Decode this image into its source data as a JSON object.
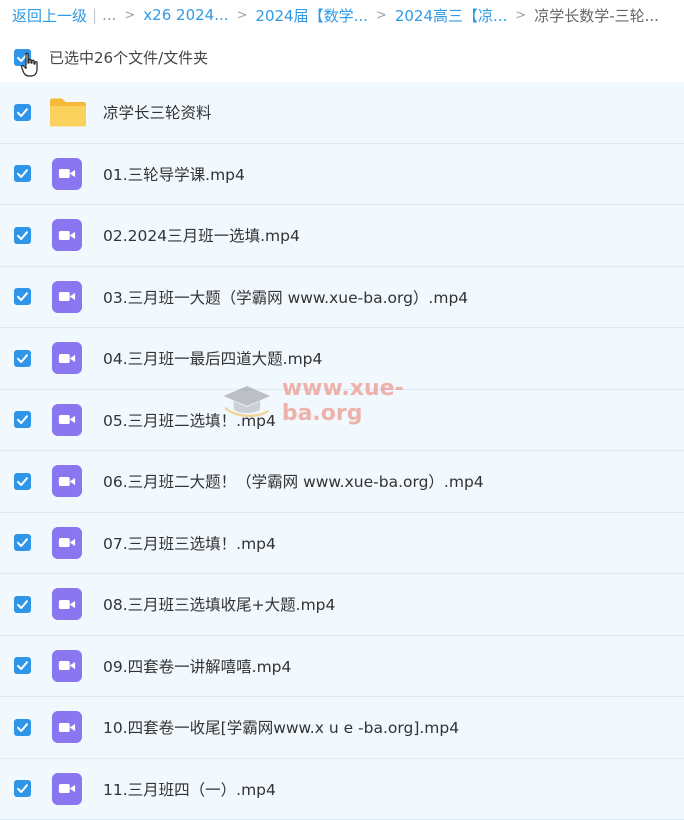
{
  "breadcrumb": {
    "back": "返回上一级",
    "pipe": "|",
    "ellipsis": "...",
    "items": [
      "x26 2024...",
      "2024届【数学...",
      "2024高三【凉...",
      "凉学长数学-三轮..."
    ]
  },
  "selection": {
    "text": "已选中26个文件/文件夹"
  },
  "files": [
    {
      "name": "凉学长三轮资料",
      "type": "folder"
    },
    {
      "name": "01.三轮导学课.mp4",
      "type": "video"
    },
    {
      "name": "02.2024三月班一选填.mp4",
      "type": "video"
    },
    {
      "name": "03.三月班一大题（学霸网 www.xue-ba.org）.mp4",
      "type": "video"
    },
    {
      "name": "04.三月班一最后四道大题.mp4",
      "type": "video"
    },
    {
      "name": "05.三月班二选填！.mp4",
      "type": "video"
    },
    {
      "name": "06.三月班二大题！（学霸网 www.xue-ba.org）.mp4",
      "type": "video"
    },
    {
      "name": "07.三月班三选填！.mp4",
      "type": "video"
    },
    {
      "name": "08.三月班三选填收尾+大题.mp4",
      "type": "video"
    },
    {
      "name": "09.四套卷一讲解嘻嘻.mp4",
      "type": "video"
    },
    {
      "name": "10.四套卷一收尾[学霸网www.x u e -ba.org].mp4",
      "type": "video"
    },
    {
      "name": "11.三月班四（一）.mp4",
      "type": "video"
    }
  ],
  "watermark": {
    "text": "www.xue-ba.org"
  },
  "colors": {
    "accent": "#2e95e8",
    "video_icon": "#8a76f0",
    "folder": "#f7c548",
    "row_bg": "#f1f8fe"
  }
}
